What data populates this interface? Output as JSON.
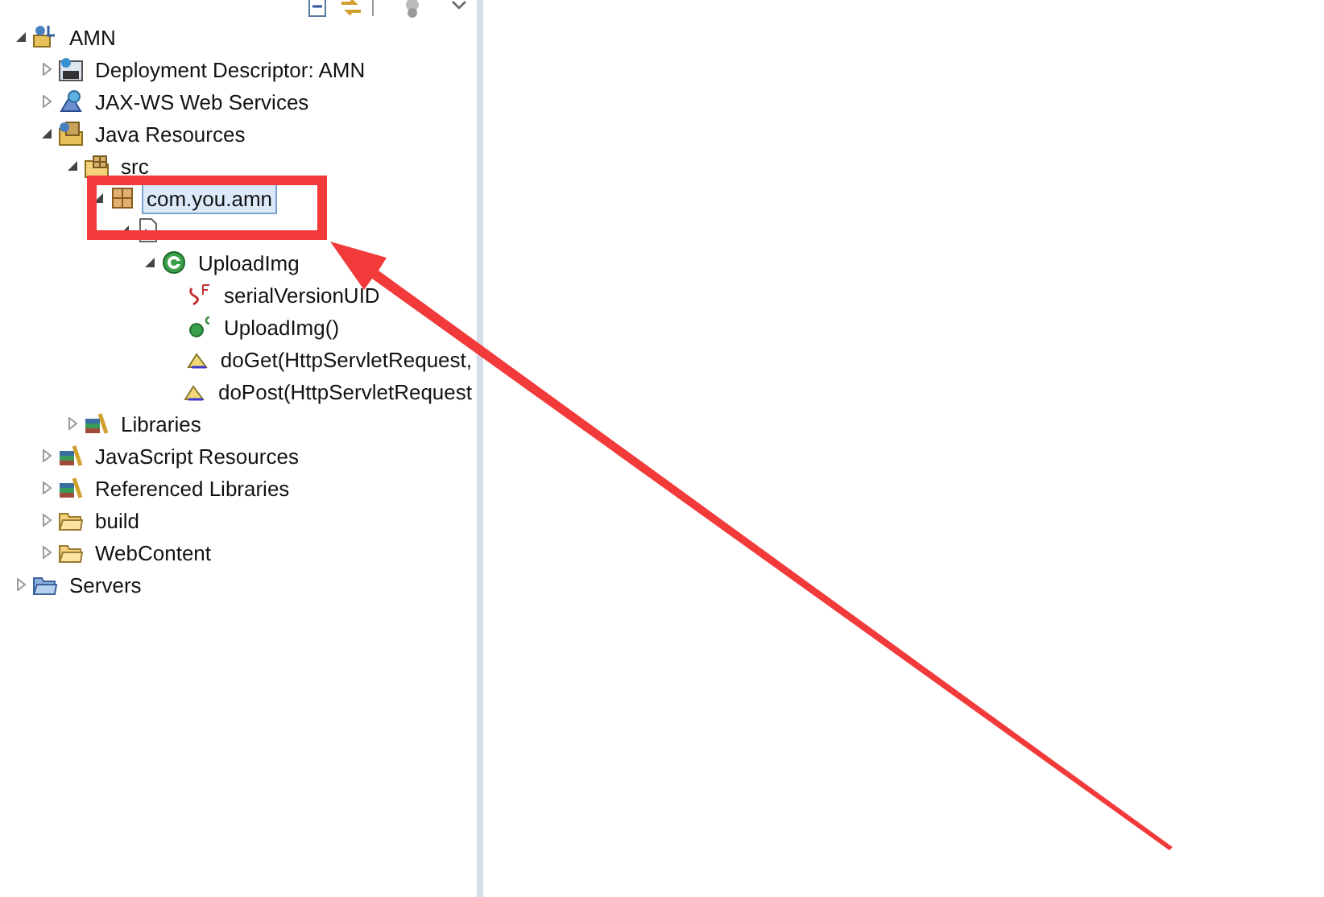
{
  "toolbar": [
    {
      "kind": "collapse"
    },
    {
      "kind": "link"
    },
    {
      "kind": "gear-disabled"
    },
    {
      "kind": "chevron"
    }
  ],
  "tree": [
    {
      "label": "AMN",
      "kind": "project",
      "expanded": true,
      "selected": false,
      "children": [
        {
          "label": "Deployment Descriptor: AMN",
          "kind": "deployment",
          "expanded": false,
          "selected": false
        },
        {
          "label": "JAX-WS Web Services",
          "kind": "webservices",
          "expanded": false,
          "selected": false
        },
        {
          "label": "Java Resources",
          "kind": "java-resources",
          "expanded": true,
          "selected": false,
          "children": [
            {
              "label": "src",
              "kind": "src-folder",
              "expanded": true,
              "selected": false,
              "children": [
                {
                  "label": "com.you.amn",
                  "kind": "package",
                  "expanded": true,
                  "selected": true,
                  "children": [
                    {
                      "kind": "java-file",
                      "expanded": true,
                      "children": [
                        {
                          "label": "UploadImg",
                          "kind": "class",
                          "expanded": true,
                          "selected": false,
                          "children": [
                            {
                              "label": "serialVersionUID",
                              "kind": "field",
                              "selected": false
                            },
                            {
                              "label": "UploadImg()",
                              "kind": "constructor",
                              "selected": false
                            },
                            {
                              "label": "doGet(HttpServletRequest,",
                              "kind": "method",
                              "selected": false
                            },
                            {
                              "label": "doPost(HttpServletRequest",
                              "kind": "method",
                              "selected": false
                            }
                          ]
                        }
                      ]
                    }
                  ]
                }
              ]
            },
            {
              "label": "Libraries",
              "kind": "library",
              "expanded": false,
              "selected": false
            }
          ]
        },
        {
          "label": "JavaScript Resources",
          "kind": "library",
          "expanded": false,
          "selected": false
        },
        {
          "label": "Referenced Libraries",
          "kind": "library",
          "expanded": false,
          "selected": false
        },
        {
          "label": "build",
          "kind": "folder",
          "expanded": false,
          "selected": false
        },
        {
          "label": "WebContent",
          "kind": "folder",
          "expanded": false,
          "selected": false
        }
      ]
    },
    {
      "label": "Servers",
      "kind": "servers-folder",
      "expanded": false,
      "selected": false
    }
  ]
}
